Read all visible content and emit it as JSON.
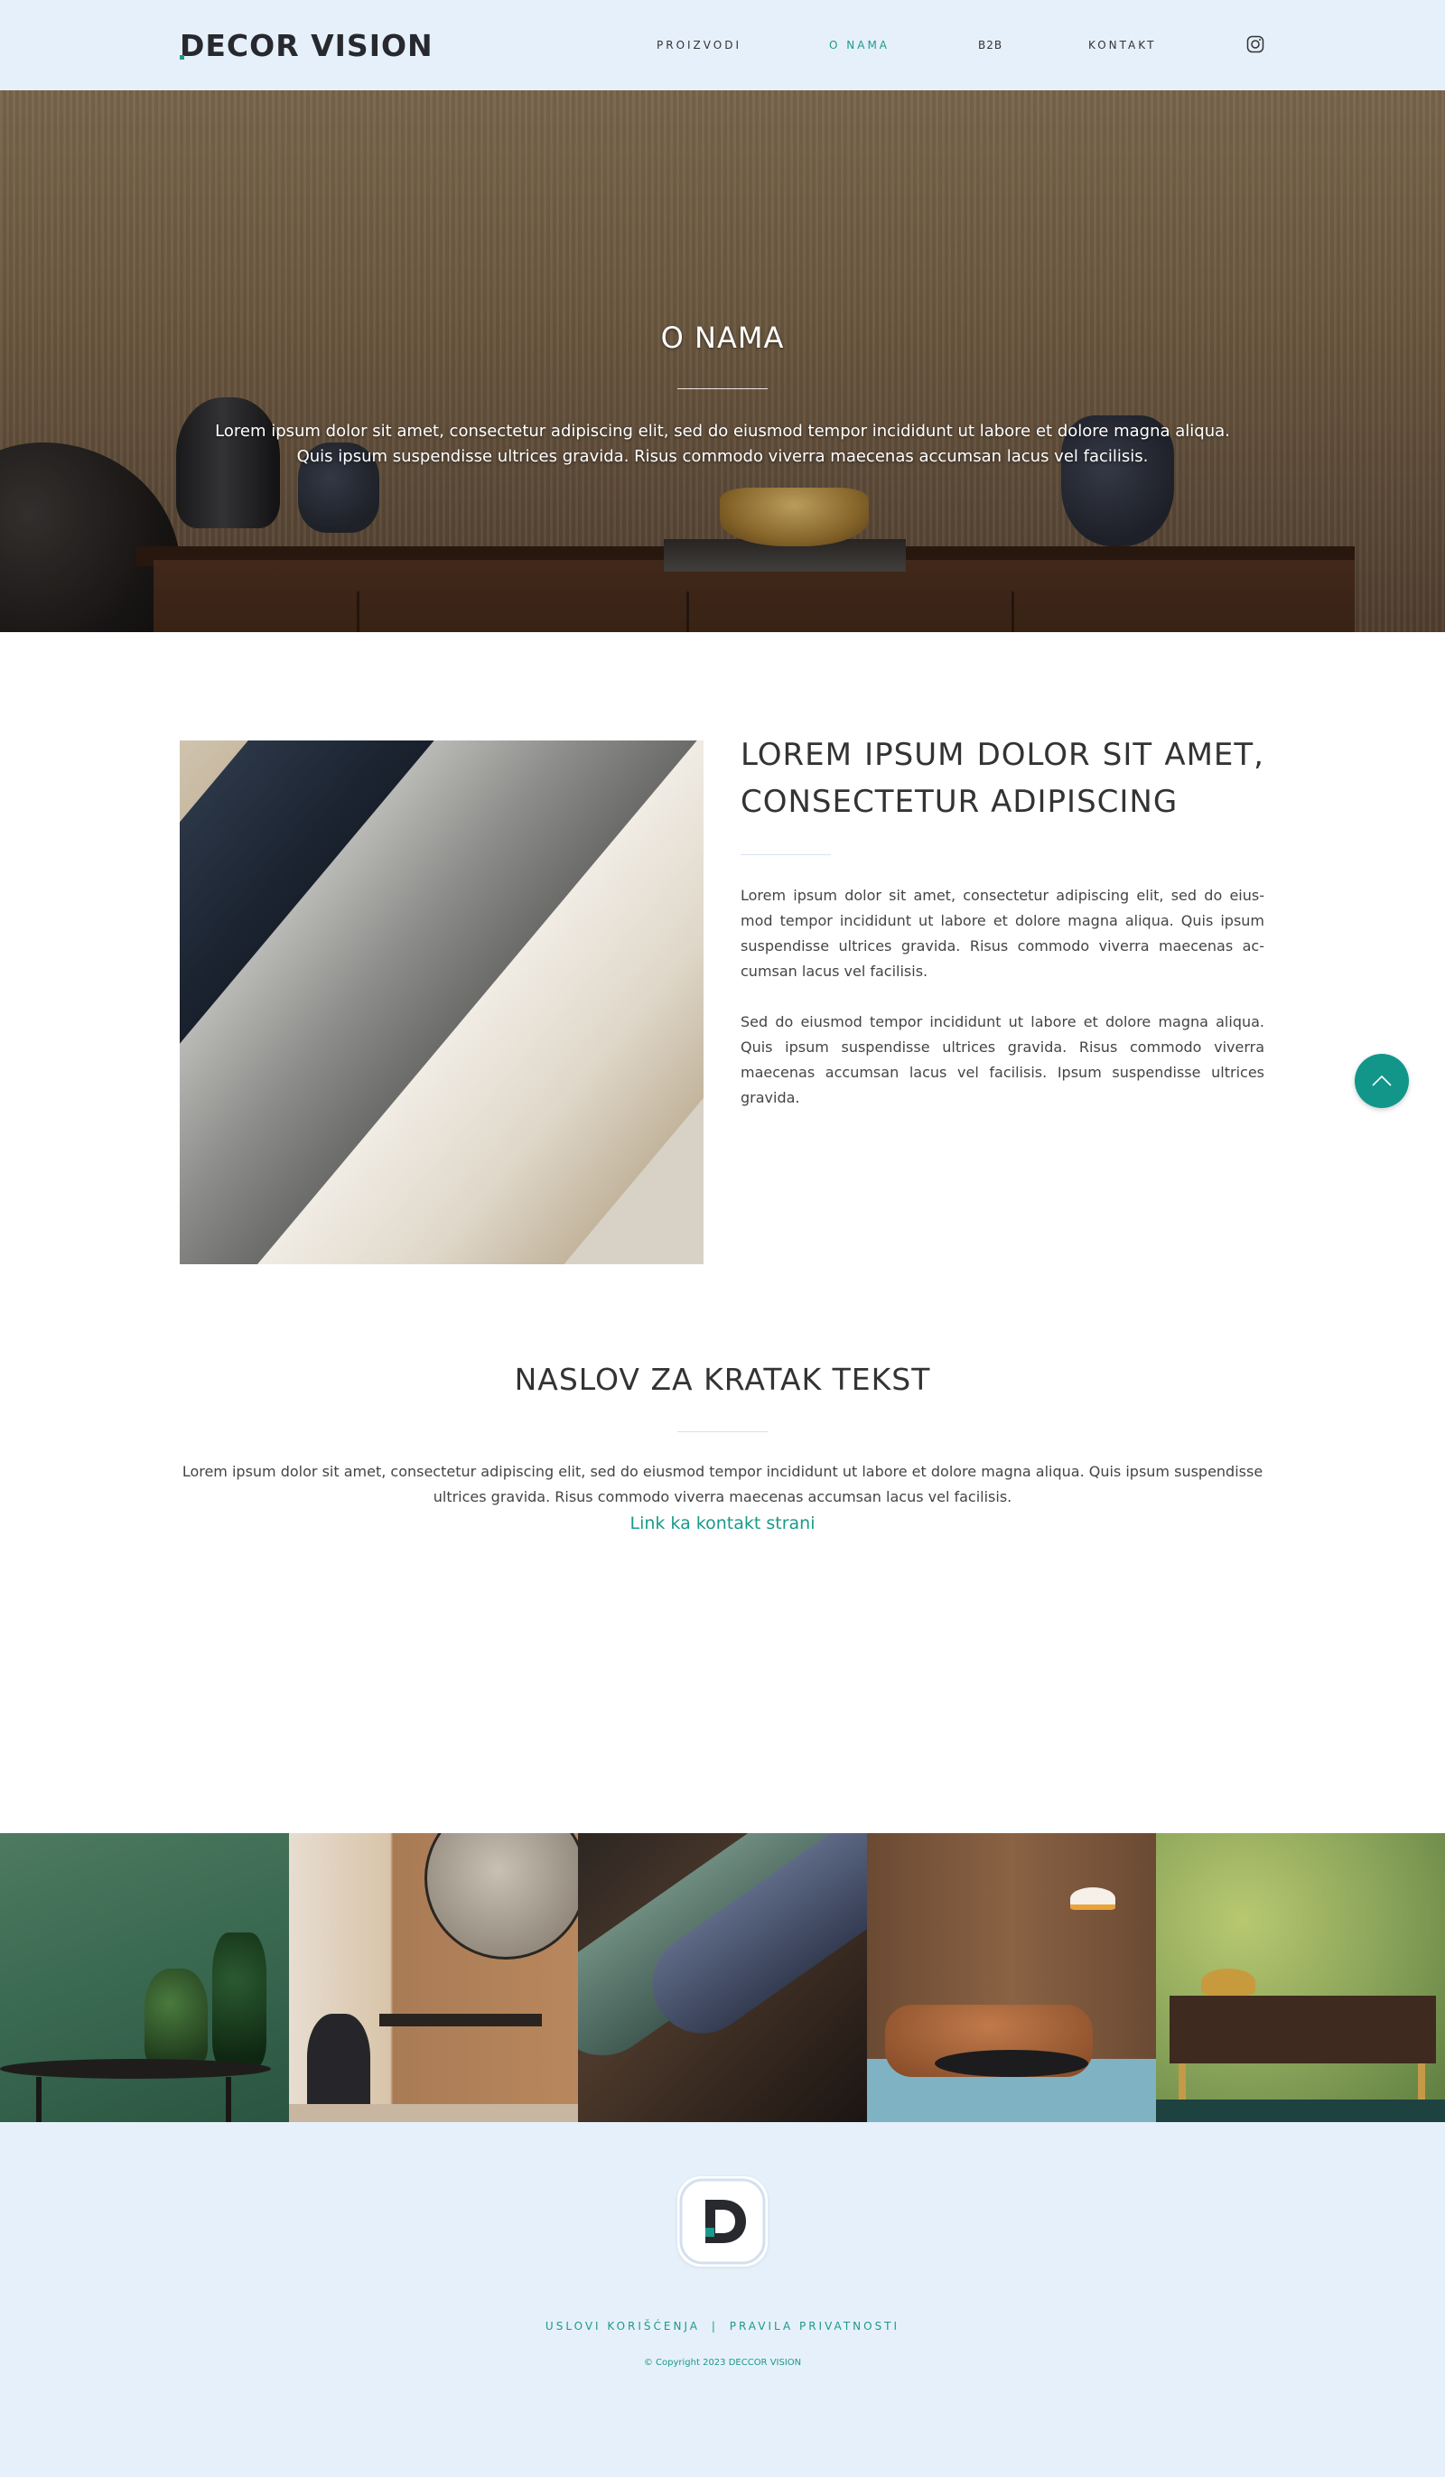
{
  "brand": {
    "name": "DECOR VISION",
    "accent_color": "#1a9a8a",
    "header_bg": "#e6f0fb"
  },
  "nav": {
    "items": [
      {
        "label": "PROIZVODI",
        "active": false
      },
      {
        "label": "O NAMA",
        "active": true
      },
      {
        "label": "B2B",
        "active": false
      },
      {
        "label": "KONTAKT",
        "active": false
      }
    ],
    "instagram_icon": "instagram-icon"
  },
  "hero": {
    "title": "O NAMA",
    "text": "Lorem ipsum dolor sit amet, consectetur adipiscing elit, sed do eiusmod tempor incididunt ut labore et dolore magna aliqua. Quis ipsum suspendisse ultrices gravida. Risus commodo viverra maecenas accumsan lacus vel facilisis.",
    "scroll_icon": "chevron-down-icon"
  },
  "about": {
    "heading": "LOREM IPSUM DOLOR SIT AMET, CONSECTETUR ADIPISCING",
    "paragraph1": "Lorem ipsum dolor sit amet, consectetur adipiscing elit, sed do eius-mod tempor incididunt ut labore et dolore magna aliqua. Quis ipsum suspendisse ultrices gravida. Risus commodo viverra maecenas ac-cumsan lacus vel facilisis.",
    "paragraph2": "Sed do eiusmod tempor incididunt ut labore et dolore magna aliqua. Quis ipsum suspendisse ultrices gravida. Risus commodo viverra maecenas accumsan lacus vel facilisis. Ipsum suspendisse ultrices gravida."
  },
  "short_text": {
    "heading": "NASLOV ZA KRATAK TEKST",
    "text": "Lorem ipsum dolor sit amet, consectetur adipiscing elit, sed do eiusmod tempor incididunt ut labore et dolore magna aliqua. Quis ipsum suspendisse ultrices gravida. Risus commodo viverra maecenas accumsan lacus vel facilisis.",
    "link": "Link ka kontakt strani"
  },
  "scroll_top": {
    "icon": "chevron-up-icon",
    "color": "#12968a"
  },
  "footer": {
    "terms": "USLOVI KORIŠĆENJA",
    "separator": "|",
    "privacy": "PRAVILA PRIVATNOSTI",
    "copyright": "© Copyright 2023 DECCOR VISION"
  }
}
